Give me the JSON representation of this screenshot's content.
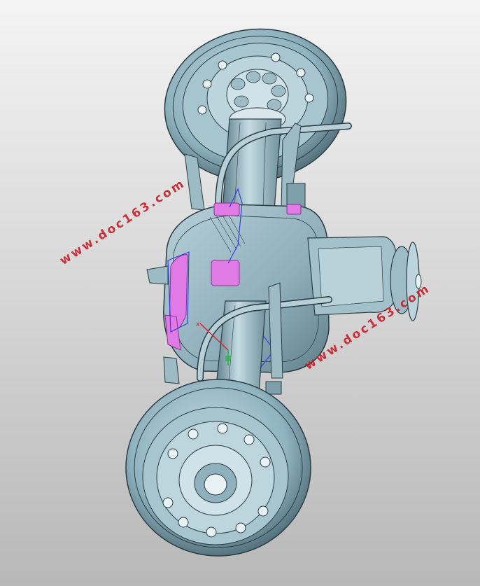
{
  "watermarks": [
    "www.doc163.com",
    "www.doc163.com"
  ],
  "colors": {
    "background_top": "#f4f4f4",
    "background_bottom": "#b8b8b8",
    "part_fill": "#8fb3c0",
    "part_light": "#c9dde4",
    "part_dark": "#4f6f7b",
    "edge": "#2b3b42",
    "highlight": "#e07be6",
    "selection": "#2f3fe6",
    "triad_red": "#e02020",
    "triad_green": "#20b040"
  }
}
